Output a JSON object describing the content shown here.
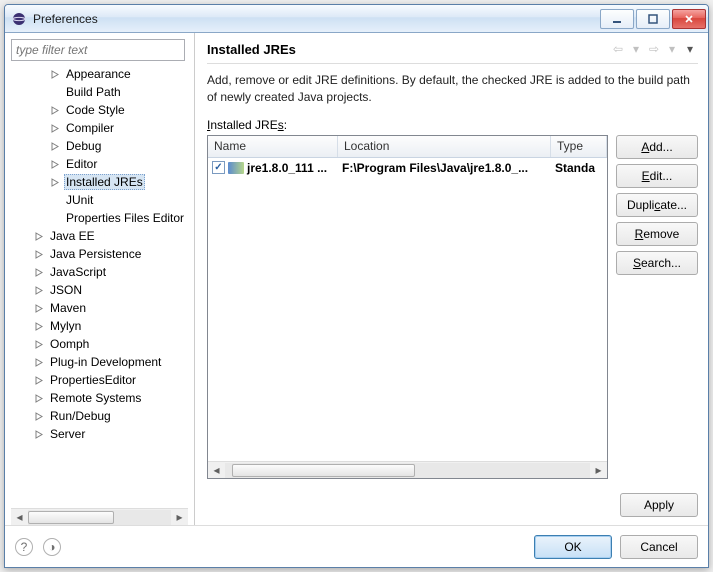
{
  "window": {
    "title": "Preferences"
  },
  "filter": {
    "placeholder": "type filter text"
  },
  "tree": {
    "items": [
      {
        "label": "Appearance",
        "depth": 2,
        "expander": true
      },
      {
        "label": "Build Path",
        "depth": 2,
        "expander": false
      },
      {
        "label": "Code Style",
        "depth": 2,
        "expander": true
      },
      {
        "label": "Compiler",
        "depth": 2,
        "expander": true
      },
      {
        "label": "Debug",
        "depth": 2,
        "expander": true
      },
      {
        "label": "Editor",
        "depth": 2,
        "expander": true
      },
      {
        "label": "Installed JREs",
        "depth": 2,
        "expander": true,
        "selected": true
      },
      {
        "label": "JUnit",
        "depth": 2,
        "expander": false
      },
      {
        "label": "Properties Files Editor",
        "depth": 2,
        "expander": false
      },
      {
        "label": "Java EE",
        "depth": 1,
        "expander": true
      },
      {
        "label": "Java Persistence",
        "depth": 1,
        "expander": true
      },
      {
        "label": "JavaScript",
        "depth": 1,
        "expander": true
      },
      {
        "label": "JSON",
        "depth": 1,
        "expander": true
      },
      {
        "label": "Maven",
        "depth": 1,
        "expander": true
      },
      {
        "label": "Mylyn",
        "depth": 1,
        "expander": true
      },
      {
        "label": "Oomph",
        "depth": 1,
        "expander": true
      },
      {
        "label": "Plug-in Development",
        "depth": 1,
        "expander": true
      },
      {
        "label": "PropertiesEditor",
        "depth": 1,
        "expander": true
      },
      {
        "label": "Remote Systems",
        "depth": 1,
        "expander": true
      },
      {
        "label": "Run/Debug",
        "depth": 1,
        "expander": true
      },
      {
        "label": "Server",
        "depth": 1,
        "expander": true
      }
    ]
  },
  "page": {
    "title": "Installed JREs",
    "description": "Add, remove or edit JRE definitions. By default, the checked JRE is added to the build path of newly created Java projects.",
    "table_label": "Installed JREs:",
    "columns": {
      "name": "Name",
      "location": "Location",
      "type": "Type"
    },
    "rows": [
      {
        "checked": true,
        "name": "jre1.8.0_111 ...",
        "location": "F:\\Program Files\\Java\\jre1.8.0_...",
        "type": "Standa"
      }
    ],
    "buttons": {
      "add": "Add...",
      "edit": "Edit...",
      "duplicate": "Duplicate...",
      "remove": "Remove",
      "search": "Search..."
    },
    "apply": "Apply"
  },
  "footer": {
    "ok": "OK",
    "cancel": "Cancel"
  }
}
